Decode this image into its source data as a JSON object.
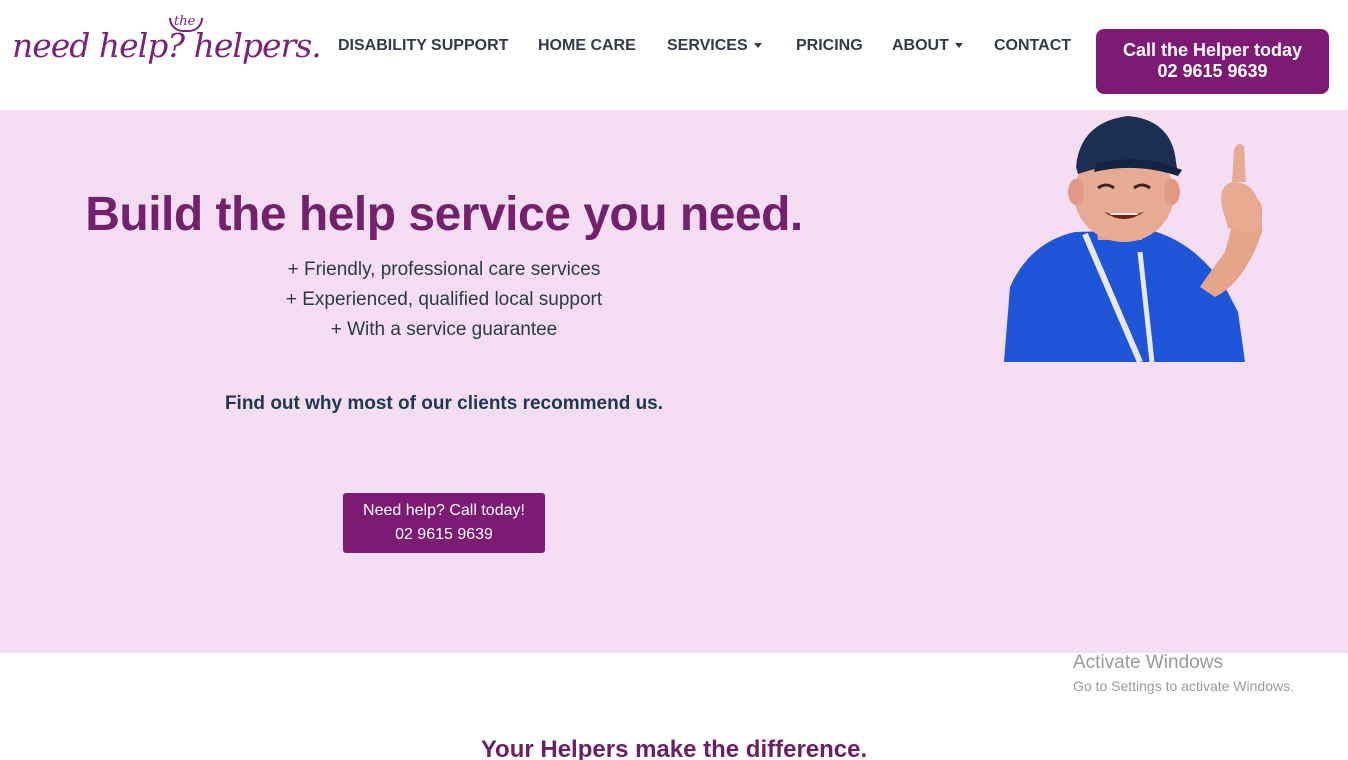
{
  "header": {
    "logo_text": "need help? helpers.",
    "logo_small": "the",
    "nav": [
      {
        "label": "DISABILITY SUPPORT",
        "dropdown": false
      },
      {
        "label": "HOME CARE",
        "dropdown": false
      },
      {
        "label": "SERVICES",
        "dropdown": true
      },
      {
        "label": "PRICING",
        "dropdown": false
      },
      {
        "label": "ABOUT",
        "dropdown": true
      },
      {
        "label": "CONTACT",
        "dropdown": false
      }
    ],
    "cta": {
      "line1": "Call the Helper today",
      "line2": "02 9615 9639"
    }
  },
  "hero": {
    "title": "Build the help service you need.",
    "bullets": [
      "+ Friendly, professional care services",
      "+ Experienced, qualified local support",
      "+ With a service guarantee"
    ],
    "recommend": "Find out why most of our clients recommend us.",
    "cta": {
      "line1": "Need help? Call today!",
      "line2": "02 9615 9639"
    }
  },
  "section": {
    "title": "Your Helpers make the difference."
  },
  "watermark": {
    "title": "Activate Windows",
    "subtitle": "Go to Settings to activate Windows."
  },
  "colors": {
    "brand": "#7d1a73",
    "hero_bg": "#f5ddf4",
    "nav_text": "#333b47"
  }
}
